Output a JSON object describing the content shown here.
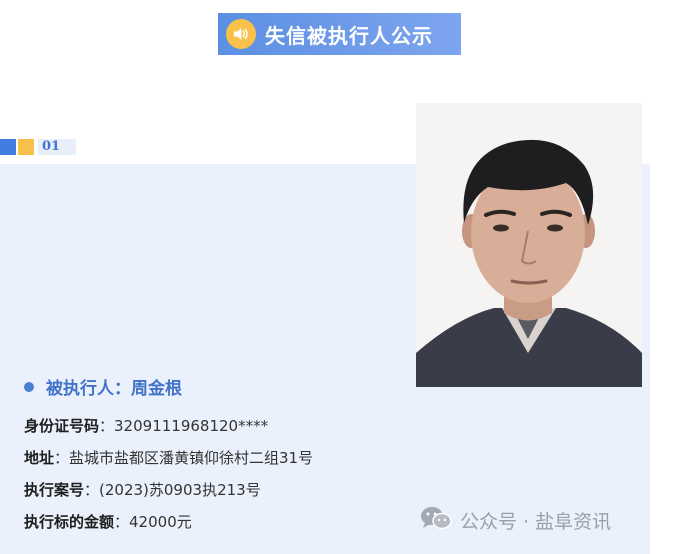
{
  "banner": {
    "title": "失信被执行人公示",
    "icon": "speaker-icon"
  },
  "section": {
    "number": "01"
  },
  "person": {
    "name_label": "被执行人：",
    "name": "周金根",
    "id_label": "身份证号码",
    "id_value": "：3209111968120****",
    "address_label": "地址",
    "address_value": "：盐城市盐都区潘黄镇仰徐村二组31号",
    "case_label": "执行案号",
    "case_value": "：(2023)苏0903执213号",
    "amount_label": "执行标的金额",
    "amount_value": "：42000元"
  },
  "watermark": {
    "icon": "wechat-icon",
    "text": "公众号 · 盐阜资讯"
  },
  "colors": {
    "banner": "#6a98e8",
    "accent_blue": "#3f7de0",
    "accent_yellow": "#f7c04a",
    "panel_bg": "#eaf1fc",
    "name_text": "#4173c9"
  }
}
